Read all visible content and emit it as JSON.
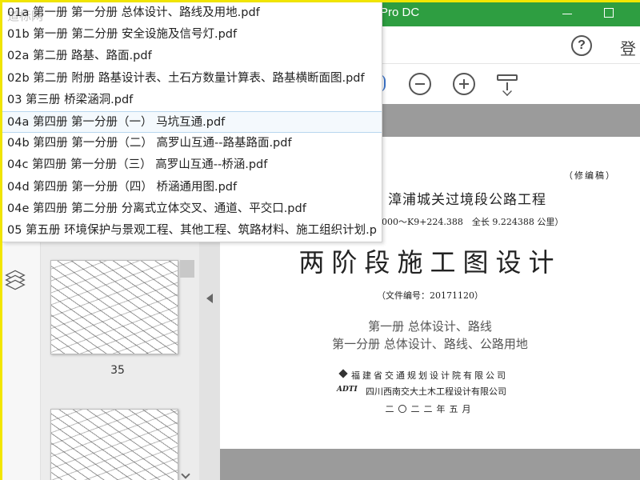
{
  "window": {
    "title_fragment": "Pro DC"
  },
  "menubar": {
    "help_glyph": "?",
    "login_fragment": "登"
  },
  "recent_files": [
    "01a 第一册 第一分册 总体设计、路线及用地.pdf",
    "01b 第一册 第二分册 安全设施及信号灯.pdf",
    "02a 第二册 路基、路面.pdf",
    "02b 第二册 附册 路基设计表、土石方数量计算表、路基横断面图.pdf",
    "03 第三册 桥梁涵洞.pdf",
    "04a 第四册 第一分册（一） 马坑互通.pdf",
    "04b 第四册 第一分册（二） 高罗山互通--路基路面.pdf",
    "04c 第四册 第一分册（三） 高罗山互通--桥涵.pdf",
    "04d 第四册 第一分册（四） 桥涵通用图.pdf",
    "04e 第四册 第二分册 分离式立体交叉、通道、平交口.pdf",
    "05 第五册 环境保护与景观工程、其他工程、筑路材料、施工组织计划.p"
  ],
  "selected_index": 5,
  "thumbnails": {
    "page_label": "35"
  },
  "document": {
    "revision": "（修编稿）",
    "project": "漳浦城关过境段公路工程",
    "range": "000～K9+224.388　全长 9.224388 公里）",
    "main_title": "两阶段施工图设计",
    "file_no": "（文件编号：20171120）",
    "volume": "第一册 总体设计、路线",
    "subvolume": "第一分册 总体设计、路线、公路用地",
    "org1": "福建省交通规划设计院有限公司",
    "org2_logo": "ADTI",
    "org2": "四川西南交大土木工程设计有限公司",
    "date": "二〇二二年五月"
  },
  "watermark": "道标网"
}
